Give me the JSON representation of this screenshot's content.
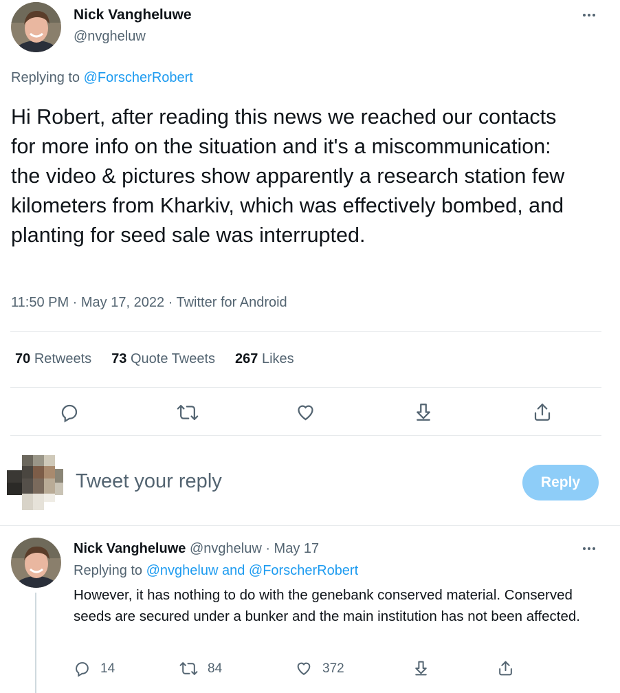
{
  "main_tweet": {
    "author_name": "Nick Vangheluwe",
    "author_handle": "@nvgheluw",
    "replying_prefix": "Replying to",
    "replying_to": "@ForscherRobert",
    "text": "Hi Robert, after reading this news we reached our contacts for more info on the situation and it's a miscommunication: the video & pictures show apparently a research station few kilometers from Kharkiv, which was effectively bombed, and planting for seed sale was interrupted.",
    "meta": "11:50 PM · May 17, 2022 · Twitter for Android",
    "stats": {
      "retweets_count": "70",
      "retweets_label": "Retweets",
      "quotes_count": "73",
      "quotes_label": "Quote Tweets",
      "likes_count": "267",
      "likes_label": "Likes"
    },
    "actions": [
      "reply-icon",
      "retweet-icon",
      "like-icon",
      "share-icon",
      "upload-icon"
    ]
  },
  "compose": {
    "placeholder": "Tweet your reply",
    "button_label": "Reply"
  },
  "reply_tweet": {
    "author_name": "Nick Vangheluwe",
    "author_handle": "@nvgheluw",
    "date": "· May 17",
    "replying_prefix": "Replying to",
    "replying_to": "@nvgheluw and @ForscherRobert",
    "text": "However, it has nothing to do with the genebank conserved material. Conserved seeds are secured under a bunker and the main institution has not been affected.",
    "reply_count": "14",
    "retweet_count": "84",
    "like_count": "372"
  },
  "colors": {
    "accent": "#1d9bf0",
    "muted": "#536471",
    "reply_button_disabled": "#8ecdf8"
  }
}
